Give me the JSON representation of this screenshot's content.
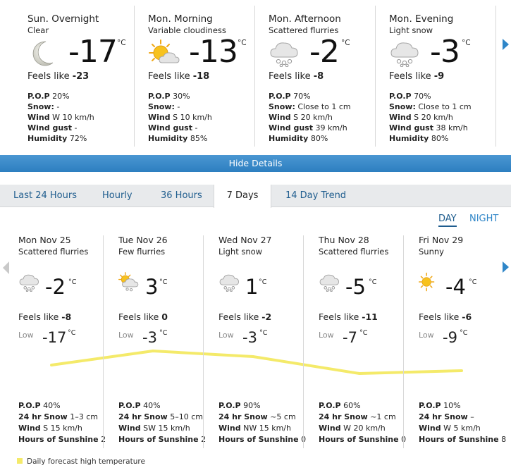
{
  "hourly": [
    {
      "title": "Sun. Overnight",
      "condition": "Clear",
      "icon": "moon-icon",
      "temp": "-17",
      "unit": "°C",
      "feels_label": "Feels like",
      "feels": "-23",
      "pop_label": "P.O.P",
      "pop": "20%",
      "snow_label": "Snow:",
      "snow": "-",
      "wind_label": "Wind",
      "wind": "W 10 km/h",
      "gust_label": "Wind gust",
      "gust": "-",
      "humidity_label": "Humidity",
      "humidity": "72%"
    },
    {
      "title": "Mon. Morning",
      "condition": "Variable cloudiness",
      "icon": "sun-cloud-icon",
      "temp": "-13",
      "unit": "°C",
      "feels_label": "Feels like",
      "feels": "-18",
      "pop_label": "P.O.P",
      "pop": "30%",
      "snow_label": "Snow:",
      "snow": "-",
      "wind_label": "Wind",
      "wind": "S 10 km/h",
      "gust_label": "Wind gust",
      "gust": "-",
      "humidity_label": "Humidity",
      "humidity": "85%"
    },
    {
      "title": "Mon. Afternoon",
      "condition": "Scattered flurries",
      "icon": "snow-cloud-icon",
      "temp": "-2",
      "unit": "°C",
      "feels_label": "Feels like",
      "feels": "-8",
      "pop_label": "P.O.P",
      "pop": "70%",
      "snow_label": "Snow:",
      "snow": "Close to 1 cm",
      "wind_label": "Wind",
      "wind": "S 20 km/h",
      "gust_label": "Wind gust",
      "gust": "39 km/h",
      "humidity_label": "Humidity",
      "humidity": "80%"
    },
    {
      "title": "Mon. Evening",
      "condition": "Light snow",
      "icon": "snow-cloud-icon",
      "temp": "-3",
      "unit": "°C",
      "feels_label": "Feels like",
      "feels": "-9",
      "pop_label": "P.O.P",
      "pop": "70%",
      "snow_label": "Snow:",
      "snow": "Close to 1 cm",
      "wind_label": "Wind",
      "wind": "S 20 km/h",
      "gust_label": "Wind gust",
      "gust": "38 km/h",
      "humidity_label": "Humidity",
      "humidity": "80%"
    }
  ],
  "details_bar": {
    "label": "Hide Details"
  },
  "tabs": [
    {
      "label": "Last 24 Hours",
      "active": false
    },
    {
      "label": "Hourly",
      "active": false
    },
    {
      "label": "36 Hours",
      "active": false
    },
    {
      "label": "7 Days",
      "active": true
    },
    {
      "label": "14 Day Trend",
      "active": false
    }
  ],
  "day_night": {
    "day": "DAY",
    "night": "NIGHT",
    "selected": "DAY"
  },
  "days": [
    {
      "date": "Mon Nov 25",
      "condition": "Scattered flurries",
      "icon": "snow-cloud-icon",
      "high": "-2",
      "unit": "°C",
      "feels_label": "Feels like",
      "feels": "-8",
      "low_label": "Low",
      "low": "-17",
      "pop_label": "P.O.P",
      "pop": "40%",
      "snow_label": "24 hr Snow",
      "snow": "1–3 cm",
      "wind_label": "Wind",
      "wind": "S 15 km/h",
      "sun_label": "Hours of Sunshine",
      "sun": "2"
    },
    {
      "date": "Tue Nov 26",
      "condition": "Few flurries",
      "icon": "sun-snow-cloud-icon",
      "high": "3",
      "unit": "°C",
      "feels_label": "Feels like",
      "feels": "0",
      "low_label": "Low",
      "low": "-3",
      "pop_label": "P.O.P",
      "pop": "40%",
      "snow_label": "24 hr Snow",
      "snow": "5–10 cm",
      "wind_label": "Wind",
      "wind": "SW 15 km/h",
      "sun_label": "Hours of Sunshine",
      "sun": "2"
    },
    {
      "date": "Wed Nov 27",
      "condition": "Light snow",
      "icon": "snow-cloud-icon",
      "high": "1",
      "unit": "°C",
      "feels_label": "Feels like",
      "feels": "-2",
      "low_label": "Low",
      "low": "-3",
      "pop_label": "P.O.P",
      "pop": "90%",
      "snow_label": "24 hr Snow",
      "snow": "~5 cm",
      "wind_label": "Wind",
      "wind": "NW 15 km/h",
      "sun_label": "Hours of Sunshine",
      "sun": "0"
    },
    {
      "date": "Thu Nov 28",
      "condition": "Scattered flurries",
      "icon": "snow-cloud-icon",
      "high": "-5",
      "unit": "°C",
      "feels_label": "Feels like",
      "feels": "-11",
      "low_label": "Low",
      "low": "-7",
      "pop_label": "P.O.P",
      "pop": "60%",
      "snow_label": "24 hr Snow",
      "snow": "~1 cm",
      "wind_label": "Wind",
      "wind": "W 20 km/h",
      "sun_label": "Hours of Sunshine",
      "sun": "0"
    },
    {
      "date": "Fri Nov 29",
      "condition": "Sunny",
      "icon": "sun-icon",
      "high": "-4",
      "unit": "°C",
      "feels_label": "Feels like",
      "feels": "-6",
      "low_label": "Low",
      "low": "-9",
      "pop_label": "P.O.P",
      "pop": "10%",
      "snow_label": "24 hr Snow",
      "snow": "–",
      "wind_label": "Wind",
      "wind": "W 5 km/h",
      "sun_label": "Hours of Sunshine",
      "sun": "8"
    }
  ],
  "legend": {
    "label": "Daily forecast high temperature",
    "color": "#f4ea6a"
  },
  "colors": {
    "accent": "#2f86c8",
    "bar": "#2d7fc0",
    "high_line": "#f4ea6a"
  }
}
